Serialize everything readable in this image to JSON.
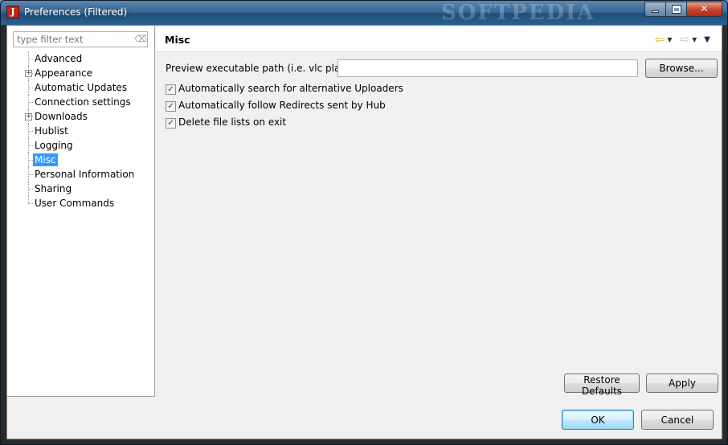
{
  "window": {
    "title": "Preferences (Filtered)",
    "app_icon_letter": "J",
    "watermark": "SOFTPEDIA"
  },
  "sidebar": {
    "filter_placeholder": "type filter text",
    "items": [
      {
        "label": "Advanced",
        "expandable": false,
        "selected": false
      },
      {
        "label": "Appearance",
        "expandable": true,
        "selected": false
      },
      {
        "label": "Automatic Updates",
        "expandable": false,
        "selected": false
      },
      {
        "label": "Connection settings",
        "expandable": false,
        "selected": false
      },
      {
        "label": "Downloads",
        "expandable": true,
        "selected": false
      },
      {
        "label": "Hublist",
        "expandable": false,
        "selected": false
      },
      {
        "label": "Logging",
        "expandable": false,
        "selected": false
      },
      {
        "label": "Misc",
        "expandable": false,
        "selected": true
      },
      {
        "label": "Personal Information",
        "expandable": false,
        "selected": false
      },
      {
        "label": "Sharing",
        "expandable": false,
        "selected": false
      },
      {
        "label": "User Commands",
        "expandable": false,
        "selected": false
      }
    ]
  },
  "page": {
    "title": "Misc",
    "preview_label": "Preview executable path (i.e. vlc player)",
    "preview_value": "",
    "browse_label": "Browse...",
    "options": [
      {
        "label": "Automatically search for alternative Uploaders",
        "checked": true
      },
      {
        "label": "Automatically follow Redirects sent by Hub",
        "checked": true
      },
      {
        "label": "Delete file lists on exit",
        "checked": true
      }
    ],
    "restore_defaults_label": "Restore Defaults",
    "apply_label": "Apply"
  },
  "footer": {
    "ok_label": "OK",
    "cancel_label": "Cancel"
  },
  "colors": {
    "selection": "#3399ff",
    "back_arrow": "#e8b020"
  }
}
